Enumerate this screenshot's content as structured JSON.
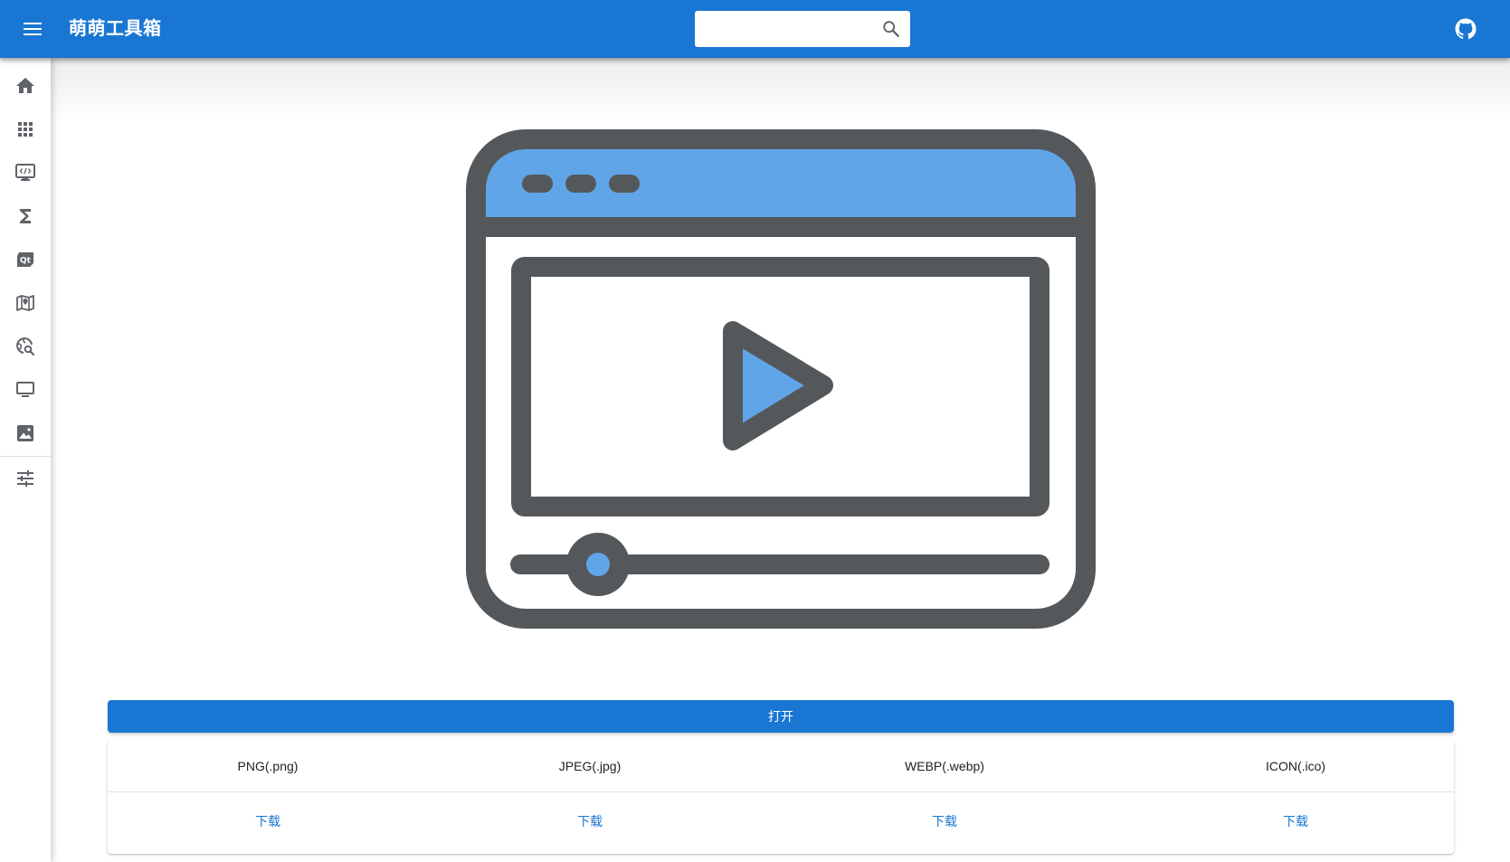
{
  "app": {
    "title": "萌萌工具箱"
  },
  "search": {
    "placeholder": "",
    "value": ""
  },
  "icons": {
    "menu": "menu-icon",
    "search": "search-icon",
    "github": "github-icon",
    "hero": "video-player-illustration"
  },
  "sidebar": {
    "items": [
      {
        "icon": "home-icon"
      },
      {
        "icon": "apps-grid-icon"
      },
      {
        "icon": "code-monitor-icon"
      },
      {
        "icon": "sigma-icon"
      },
      {
        "icon": "qt-icon"
      },
      {
        "icon": "map-marker-icon"
      },
      {
        "icon": "web-search-icon"
      },
      {
        "icon": "monitor-icon"
      },
      {
        "icon": "image-icon"
      },
      {
        "icon": "tune-icon"
      }
    ]
  },
  "main": {
    "open_label": "打开",
    "formats": [
      {
        "name": "PNG(.png)",
        "action": "下载"
      },
      {
        "name": "JPEG(.jpg)",
        "action": "下载"
      },
      {
        "name": "WEBP(.webp)",
        "action": "下载"
      },
      {
        "name": "ICON(.ico)",
        "action": "下载"
      }
    ]
  },
  "colors": {
    "primary": "#1976d2",
    "illustration_blue": "#60a5e8",
    "illustration_stroke": "#54585a",
    "sidebar_icon": "#5f6368"
  }
}
